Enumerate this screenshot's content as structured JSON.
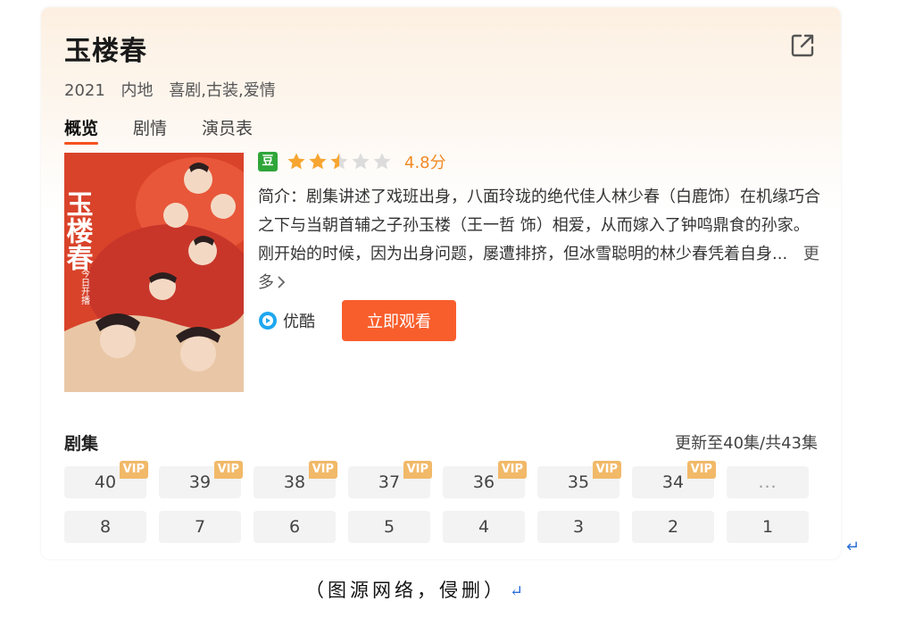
{
  "show": {
    "title": "玉楼春",
    "year": "2021",
    "region": "内地",
    "genres": "喜剧,古装,爱情"
  },
  "tabs": [
    {
      "label": "概览",
      "active": true
    },
    {
      "label": "剧情",
      "active": false
    },
    {
      "label": "演员表",
      "active": false
    }
  ],
  "poster": {
    "title_text": "玉楼春",
    "subtitle_text": "今日开播"
  },
  "rating": {
    "source_icon": "douban-icon",
    "source_glyph": "豆",
    "stars_filled": 2.5,
    "stars_total": 5,
    "score": "4.8分"
  },
  "intro": {
    "text": "简介：剧集讲述了戏班出身，八面玲珑的绝代佳人林少春（白鹿饰）在机缘巧合之下与当朝首辅之子孙玉楼（王一哲 饰）相爱，从而嫁入了钟鸣鼎食的孙家。刚开始的时候，因为出身问题，屡遭排挤，但冰雪聪明的林少春凭着自身...",
    "more_label": "更多"
  },
  "source": {
    "name": "优酷",
    "icon": "youku-icon",
    "watch_label": "立即观看"
  },
  "episodes": {
    "section_title": "剧集",
    "update_status": "更新至40集/共43集",
    "row1": [
      {
        "num": "40",
        "vip": "VIP"
      },
      {
        "num": "39",
        "vip": "VIP"
      },
      {
        "num": "38",
        "vip": "VIP"
      },
      {
        "num": "37",
        "vip": "VIP"
      },
      {
        "num": "36",
        "vip": "VIP"
      },
      {
        "num": "35",
        "vip": "VIP"
      },
      {
        "num": "34",
        "vip": "VIP"
      },
      {
        "num": "...",
        "vip": ""
      }
    ],
    "row2": [
      "8",
      "7",
      "6",
      "5",
      "4",
      "3",
      "2",
      "1"
    ]
  },
  "caption": "（图源网络，侵删）",
  "colors": {
    "accent": "#f85e2c",
    "star": "#f7a531",
    "star_empty": "#dcdcdc",
    "vip": "#f1b968",
    "douban": "#2fa63a"
  }
}
